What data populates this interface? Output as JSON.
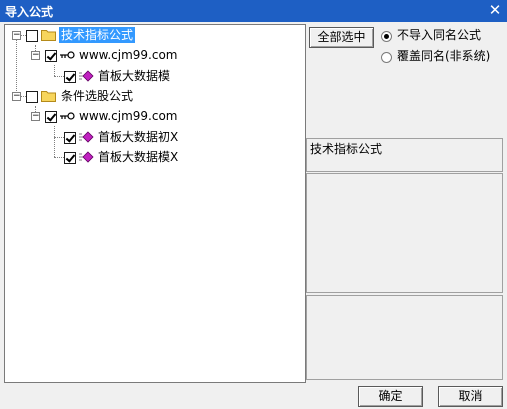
{
  "window": {
    "title": "导入公式",
    "close_glyph": "✕"
  },
  "tree": {
    "groups": [
      {
        "label": "技术指标公式",
        "expander": "−",
        "checked": false,
        "selected": true,
        "site": {
          "label": "www.cjm99.com",
          "checked": true
        },
        "items": [
          {
            "label": "首板大数据模",
            "checked": true
          }
        ]
      },
      {
        "label": "条件选股公式",
        "expander": "−",
        "checked": false,
        "selected": false,
        "site": {
          "label": "www.cjm99.com",
          "checked": true
        },
        "items": [
          {
            "label": "首板大数据初X",
            "checked": true
          },
          {
            "label": "首板大数据模X",
            "checked": true
          }
        ]
      }
    ]
  },
  "options": {
    "select_all_label": "全部选中",
    "radio_skip_label": "不导入同名公式",
    "radio_overwrite_label": "覆盖同名(非系统)",
    "selected_radio": "skip"
  },
  "info": {
    "type_label": "技术指标公式"
  },
  "footer": {
    "ok_label": "确定",
    "cancel_label": "取消"
  },
  "colors": {
    "titlebar": "#1e5fc4",
    "selection": "#3399ff"
  }
}
